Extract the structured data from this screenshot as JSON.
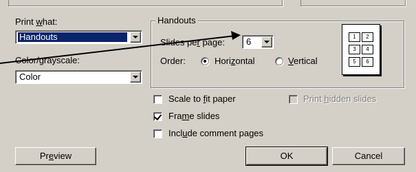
{
  "print_what": {
    "label_pre": "Print ",
    "label_key": "w",
    "label_post": "hat:",
    "value": "Handouts"
  },
  "color_grayscale": {
    "label_pre": "Color/",
    "label_key": "g",
    "label_post": "rayscale:",
    "value": "Color"
  },
  "handouts": {
    "group_title": "Handouts",
    "slides_per_page": {
      "label_pre": "Slides pe",
      "label_key": "r",
      "label_post": " page:",
      "value": "6"
    },
    "order": {
      "label": "Order:",
      "horizontal": {
        "pre": "Hori",
        "key": "z",
        "post": "ontal",
        "selected": true
      },
      "vertical": {
        "pre": "",
        "key": "V",
        "post": "ertical",
        "selected": false
      }
    },
    "preview_numbers": [
      "1",
      "2",
      "3",
      "4",
      "5",
      "6"
    ]
  },
  "options": {
    "scale_to_fit": {
      "pre": "Scale to ",
      "key": "f",
      "post": "it paper",
      "checked": false
    },
    "print_hidden": {
      "pre": "Print ",
      "key": "h",
      "post": "idden slides",
      "checked": false,
      "enabled": false
    },
    "frame_slides": {
      "pre": "Fra",
      "key": "m",
      "post": "e slides",
      "checked": true
    },
    "include_comments": {
      "pre": "Incl",
      "key": "u",
      "post": "de comment pages",
      "checked": false
    }
  },
  "buttons": {
    "preview": {
      "pre": "Pr",
      "key": "e",
      "post": "view"
    },
    "ok": "OK",
    "cancel": "Cancel"
  },
  "colors": {
    "face": "#d4d0c8",
    "selection": "#0a246a"
  }
}
